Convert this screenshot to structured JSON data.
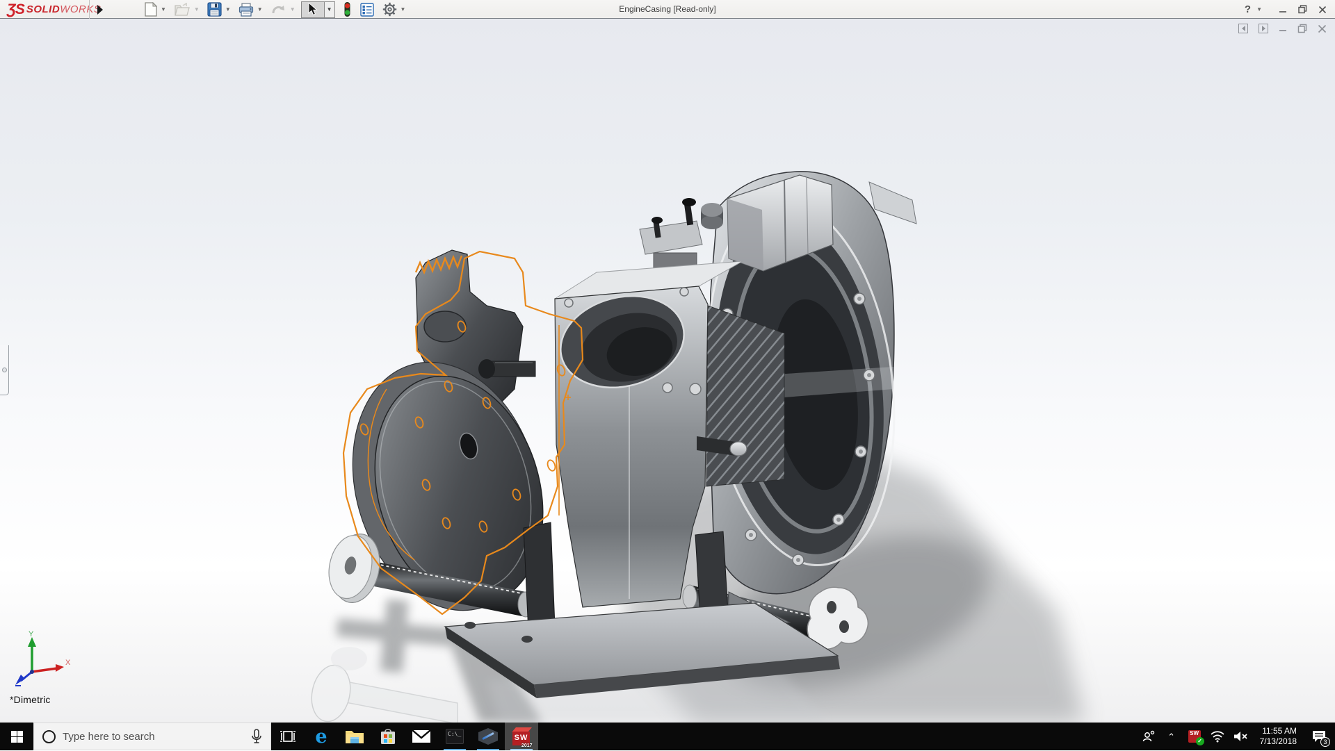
{
  "window": {
    "logo": {
      "prefix": "ƷS",
      "brand_bold": "SOLID",
      "brand_light": "WORKS"
    },
    "title": "EngineCasing [Read-only]",
    "toolbar_icons": [
      "flyout-expand-arrow",
      "new-document-icon",
      "open-icon",
      "save-icon",
      "print-icon",
      "undo-icon",
      "select-cursor-icon",
      "traffic-light-icon",
      "display-manager-icon",
      "options-gear-icon"
    ],
    "controls": {
      "help": "?",
      "minimize": "minimize",
      "restore": "restore",
      "close": "✕"
    }
  },
  "viewport": {
    "orientation_label": "*Dimetric",
    "triad": {
      "x": "X",
      "y": "Y"
    },
    "doc_window_controls": [
      "previous-pane",
      "next-pane",
      "minimize",
      "restore",
      "close"
    ],
    "model_name": "EngineCasing",
    "sketch_color": "#e8891c"
  },
  "taskbar": {
    "search": {
      "placeholder": "Type here to search"
    },
    "apps": [
      {
        "name": "task-view",
        "open": false
      },
      {
        "name": "edge",
        "open": false,
        "glyph": "e"
      },
      {
        "name": "file-explorer",
        "open": false
      },
      {
        "name": "store",
        "open": false
      },
      {
        "name": "mail",
        "open": false
      },
      {
        "name": "command-prompt",
        "open": true,
        "glyph": "C:\\_"
      },
      {
        "name": "edrawings",
        "open": true
      },
      {
        "name": "solidworks-2017",
        "open": true,
        "active": true,
        "letters": [
          "S",
          "W"
        ],
        "badge_year": "2017"
      }
    ],
    "tray": {
      "sw_badge": "SW",
      "time": "11:55 AM",
      "date": "7/13/2018",
      "notifications": "3"
    }
  }
}
